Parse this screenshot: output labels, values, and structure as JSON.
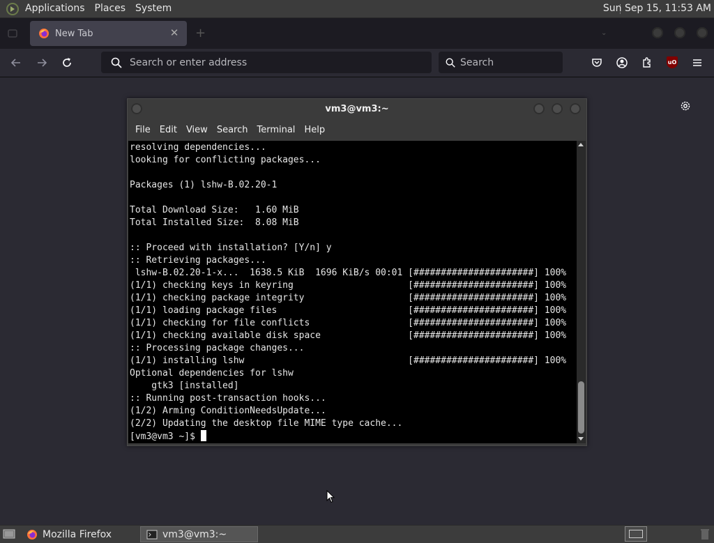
{
  "top_panel": {
    "menus": [
      "Applications",
      "Places",
      "System"
    ],
    "clock": "Sun Sep 15, 11:53 AM"
  },
  "browser": {
    "tab_title": "New Tab",
    "url_placeholder": "Search or enter address",
    "search_placeholder": "Search"
  },
  "terminal": {
    "title": "vm3@vm3:~",
    "menu": [
      "File",
      "Edit",
      "View",
      "Search",
      "Terminal",
      "Help"
    ],
    "lines": [
      "resolving dependencies...",
      "looking for conflicting packages...",
      "",
      "Packages (1) lshw-B.02.20-1",
      "",
      "Total Download Size:   1.60 MiB",
      "Total Installed Size:  8.08 MiB",
      "",
      ":: Proceed with installation? [Y/n] y",
      ":: Retrieving packages...",
      " lshw-B.02.20-1-x...  1638.5 KiB  1696 KiB/s 00:01 [######################] 100%",
      "(1/1) checking keys in keyring                     [######################] 100%",
      "(1/1) checking package integrity                   [######################] 100%",
      "(1/1) loading package files                        [######################] 100%",
      "(1/1) checking for file conflicts                  [######################] 100%",
      "(1/1) checking available disk space                [######################] 100%",
      ":: Processing package changes...",
      "(1/1) installing lshw                              [######################] 100%",
      "Optional dependencies for lshw",
      "    gtk3 [installed]",
      ":: Running post-transaction hooks...",
      "(1/2) Arming ConditionNeedsUpdate...",
      "(2/2) Updating the desktop file MIME type cache..."
    ],
    "prompt": "[vm3@vm3 ~]$ "
  },
  "taskbar": {
    "tasks": [
      "Mozilla Firefox",
      "vm3@vm3:~"
    ]
  }
}
